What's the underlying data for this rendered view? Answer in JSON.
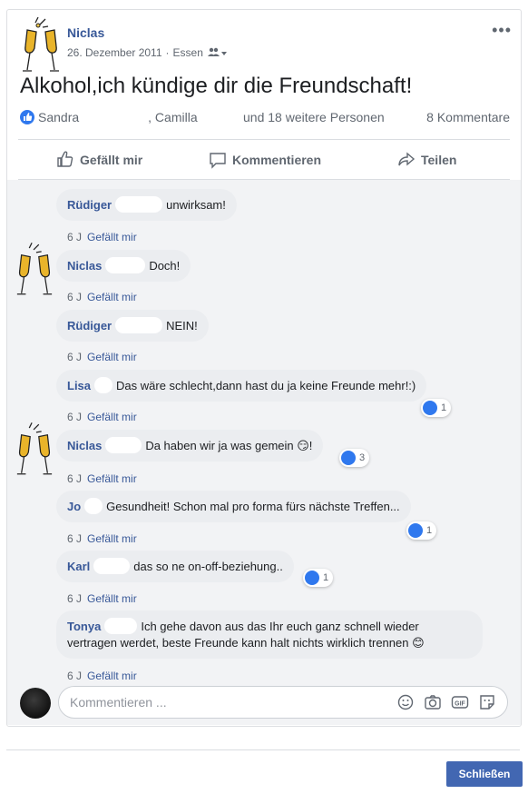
{
  "post": {
    "author": "Niclas",
    "date": "26. Dezember 2011",
    "separator": "·",
    "location": "Essen",
    "text": "Alkohol,ich kündige dir die Freundschaft!",
    "reactions": {
      "name1": "Sandra",
      "name2": ", Camilla",
      "others": "und 18 weitere Personen",
      "comments": "8 Kommentare"
    },
    "actions": {
      "like": "Gefällt mir",
      "comment": "Kommentieren",
      "share": "Teilen"
    }
  },
  "comments": [
    {
      "name": "Rüdiger",
      "text": "unwirksam!",
      "time": "6 J",
      "like": "Gefällt mir"
    },
    {
      "name": "Niclas",
      "text": "Doch!",
      "time": "6 J",
      "like": "Gefällt mir"
    },
    {
      "name": "Rüdiger",
      "text": "NEIN!",
      "time": "6 J",
      "like": "Gefällt mir"
    },
    {
      "name": "Lisa",
      "text": "Das wäre schlecht,dann hast du ja keine Freunde mehr!:)",
      "time": "6 J",
      "like": "Gefällt mir",
      "reactions": "1"
    },
    {
      "name": "Niclas",
      "text": "Da haben wir ja was gemein 😏!",
      "time": "6 J",
      "like": "Gefällt mir",
      "reactions": "3"
    },
    {
      "name": "Jo",
      "text": "Gesundheit! Schon mal pro forma fürs nächste Treffen...",
      "time": "6 J",
      "like": "Gefällt mir",
      "reactions": "1"
    },
    {
      "name": "Karl",
      "text": "das so ne on-off-beziehung..",
      "time": "6 J",
      "like": "Gefällt mir",
      "reactions": "1"
    },
    {
      "name": "Tonya",
      "text": "Ich gehe davon aus das Ihr euch ganz schnell wieder",
      "text2": "vertragen werdet, beste Freunde kann halt nichts wirklich trennen 😊",
      "time": "6 J",
      "like": "Gefällt mir"
    }
  ],
  "composer": {
    "placeholder": "Kommentieren ..."
  },
  "footer": {
    "close": "Schließen"
  },
  "colors": {
    "link": "#385898",
    "like_blue": "#2f78ee",
    "button": "#4267b2"
  },
  "icons": [
    "champagne-glasses-icon",
    "friends-audience-icon",
    "more-icon",
    "like-icon",
    "comment-icon",
    "share-icon",
    "emoji-icon",
    "camera-icon",
    "gif-icon",
    "sticker-icon"
  ]
}
